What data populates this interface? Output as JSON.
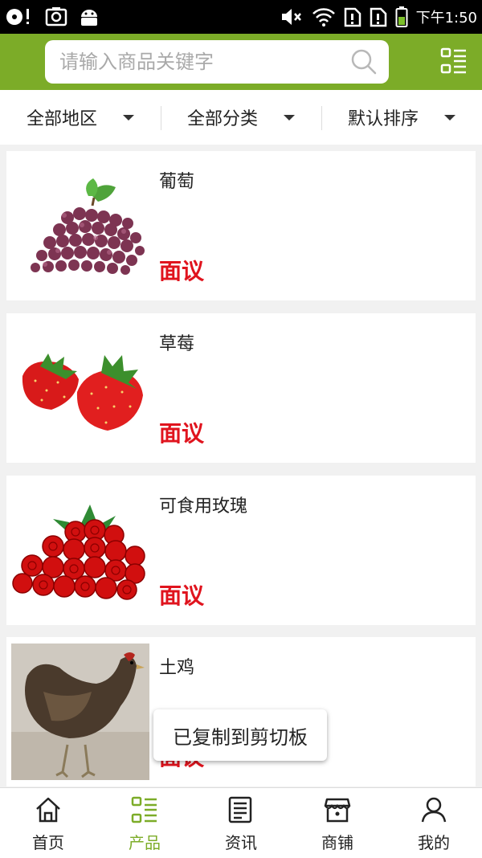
{
  "status_bar": {
    "time": "下午1:50"
  },
  "search": {
    "placeholder": "请输入商品关键字"
  },
  "filters": [
    {
      "label": "全部地区"
    },
    {
      "label": "全部分类"
    },
    {
      "label": "默认排序"
    }
  ],
  "products": [
    {
      "title": "葡萄",
      "price": "面议"
    },
    {
      "title": "草莓",
      "price": "面议"
    },
    {
      "title": "可食用玫瑰",
      "price": "面议"
    },
    {
      "title": "土鸡",
      "price": "面议"
    }
  ],
  "toast": {
    "text": "已复制到剪切板"
  },
  "bottom_nav": {
    "items": [
      {
        "label": "首页",
        "icon": "home-icon"
      },
      {
        "label": "产品",
        "icon": "product-grid-icon"
      },
      {
        "label": "资讯",
        "icon": "news-icon"
      },
      {
        "label": "商铺",
        "icon": "shop-icon"
      },
      {
        "label": "我的",
        "icon": "user-icon"
      }
    ],
    "active_index": 1
  },
  "colors": {
    "brand_green": "#7cac28",
    "price_red": "#e0141e"
  }
}
